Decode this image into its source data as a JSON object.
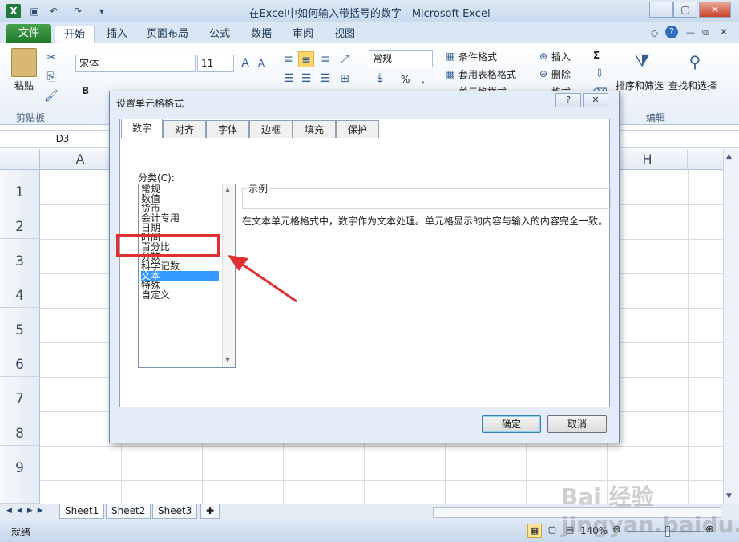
{
  "window": {
    "title": "在Excel中如何输入带括号的数字 - Microsoft Excel"
  },
  "ribbon_tabs": [
    "文件",
    "开始",
    "插入",
    "页面布局",
    "公式",
    "数据",
    "审阅",
    "视图"
  ],
  "ribbon": {
    "paste_label": "粘贴",
    "clipboard_group": "剪贴板",
    "font_name": "宋体",
    "font_size": "11",
    "bold": "B",
    "number_format": "常规",
    "percent": "%",
    "comma": ",",
    "conditional_format": "条件格式",
    "table_format": "套用表格格式",
    "cell_styles": "单元格样式",
    "insert": "插入",
    "delete": "删除",
    "format": "格式",
    "sort_filter": "排序和筛选",
    "find_select": "查找和选择",
    "edit_group": "编辑",
    "sum": "Σ"
  },
  "namebox": "D3",
  "columns": [
    "A",
    "H"
  ],
  "rows": [
    "1",
    "2",
    "3",
    "4",
    "5",
    "6",
    "7",
    "8",
    "9"
  ],
  "sheets": [
    "Sheet1",
    "Sheet2",
    "Sheet3"
  ],
  "status": {
    "ready": "就绪",
    "zoom": "140%"
  },
  "dialog": {
    "title": "设置单元格格式",
    "help": "?",
    "close": "✕",
    "tabs": [
      "数字",
      "对齐",
      "字体",
      "边框",
      "填充",
      "保护"
    ],
    "category_label": "分类(C):",
    "categories": [
      "常规",
      "数值",
      "货币",
      "会计专用",
      "日期",
      "时间",
      "百分比",
      "分数",
      "科学记数",
      "文本",
      "特殊",
      "自定义"
    ],
    "sample_label": "示例",
    "description": "在文本单元格格式中，数字作为文本处理。单元格显示的内容与输入的内容完全一致。",
    "ok": "确定",
    "cancel": "取消"
  },
  "watermark": "Bai 经验 jingyan.baidu.com",
  "colors": {
    "selection": "#3399ff",
    "annotation": "#e03030",
    "file_tab": "#2e8b3a"
  }
}
